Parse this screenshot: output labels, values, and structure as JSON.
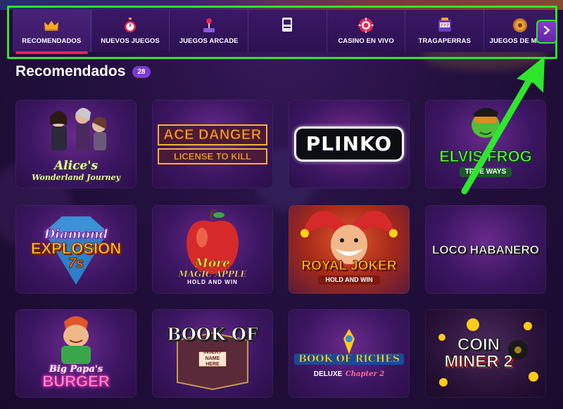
{
  "nav": {
    "tabs": [
      {
        "label": "RECOMENDADOS",
        "icon": "crown-icon",
        "active": true
      },
      {
        "label": "NUEVOS JUEGOS",
        "icon": "stopwatch-icon",
        "active": false
      },
      {
        "label": "JUEGOS ARCADE",
        "icon": "joystick-icon",
        "active": false
      },
      {
        "label": "",
        "icon": "arcade-machine-icon",
        "active": false
      },
      {
        "label": "CASINO EN VIVO",
        "icon": "poker-chip-icon",
        "active": false
      },
      {
        "label": "TRAGAPERRAS",
        "icon": "slot-machine-icon",
        "active": false
      },
      {
        "label": "JUEGOS DE MESA",
        "icon": "roulette-icon",
        "active": false
      }
    ],
    "next_icon": "chevron-right-icon"
  },
  "section": {
    "title": "Recomendados",
    "count": "28"
  },
  "games": [
    {
      "name": "Alice's Wonderland Journey",
      "line1": "Alice's",
      "line2": "Wonderland Journey"
    },
    {
      "name": "Ace Danger License to Kill",
      "line1": "ACE DANGER",
      "line2": "LICENSE TO KILL"
    },
    {
      "name": "Plinko",
      "line1": "PLINKO",
      "line2": ""
    },
    {
      "name": "Elvis Frog True Ways",
      "line1": "ELVIS FROG",
      "line2": "TRUE WAYS"
    },
    {
      "name": "Diamond Explosion 7s",
      "line1": "Diamond",
      "line2": "EXPLOSION",
      "line3": "7s"
    },
    {
      "name": "More Magic Apple Hold and Win",
      "line1": "More",
      "line2": "MAGIC APPLE",
      "line3": "HOLD AND WIN"
    },
    {
      "name": "Royal Joker Hold and Win",
      "line1": "ROYAL JOKER",
      "line2": "HOLD AND WIN"
    },
    {
      "name": "Loco Habanero",
      "line1": "LOCO HABANERO",
      "line2": ""
    },
    {
      "name": "Big Papa's Burger",
      "line1": "Big Papa's",
      "line2": "BURGER"
    },
    {
      "name": "Book of Insert Name Here",
      "line1": "BOOK OF",
      "line2": "INSERT NAME HERE"
    },
    {
      "name": "Book of Riches Deluxe Chapter 2",
      "line1": "BOOK OF RICHES",
      "line2": "DELUXE",
      "line3": "Chapter 2"
    },
    {
      "name": "Coin Miner 2",
      "line1": "COIN",
      "line2": "MINER 2"
    }
  ],
  "colors": {
    "accent_red": "#e6244d",
    "highlight_green": "#2ee62e",
    "badge_purple": "#7a3bd6"
  }
}
